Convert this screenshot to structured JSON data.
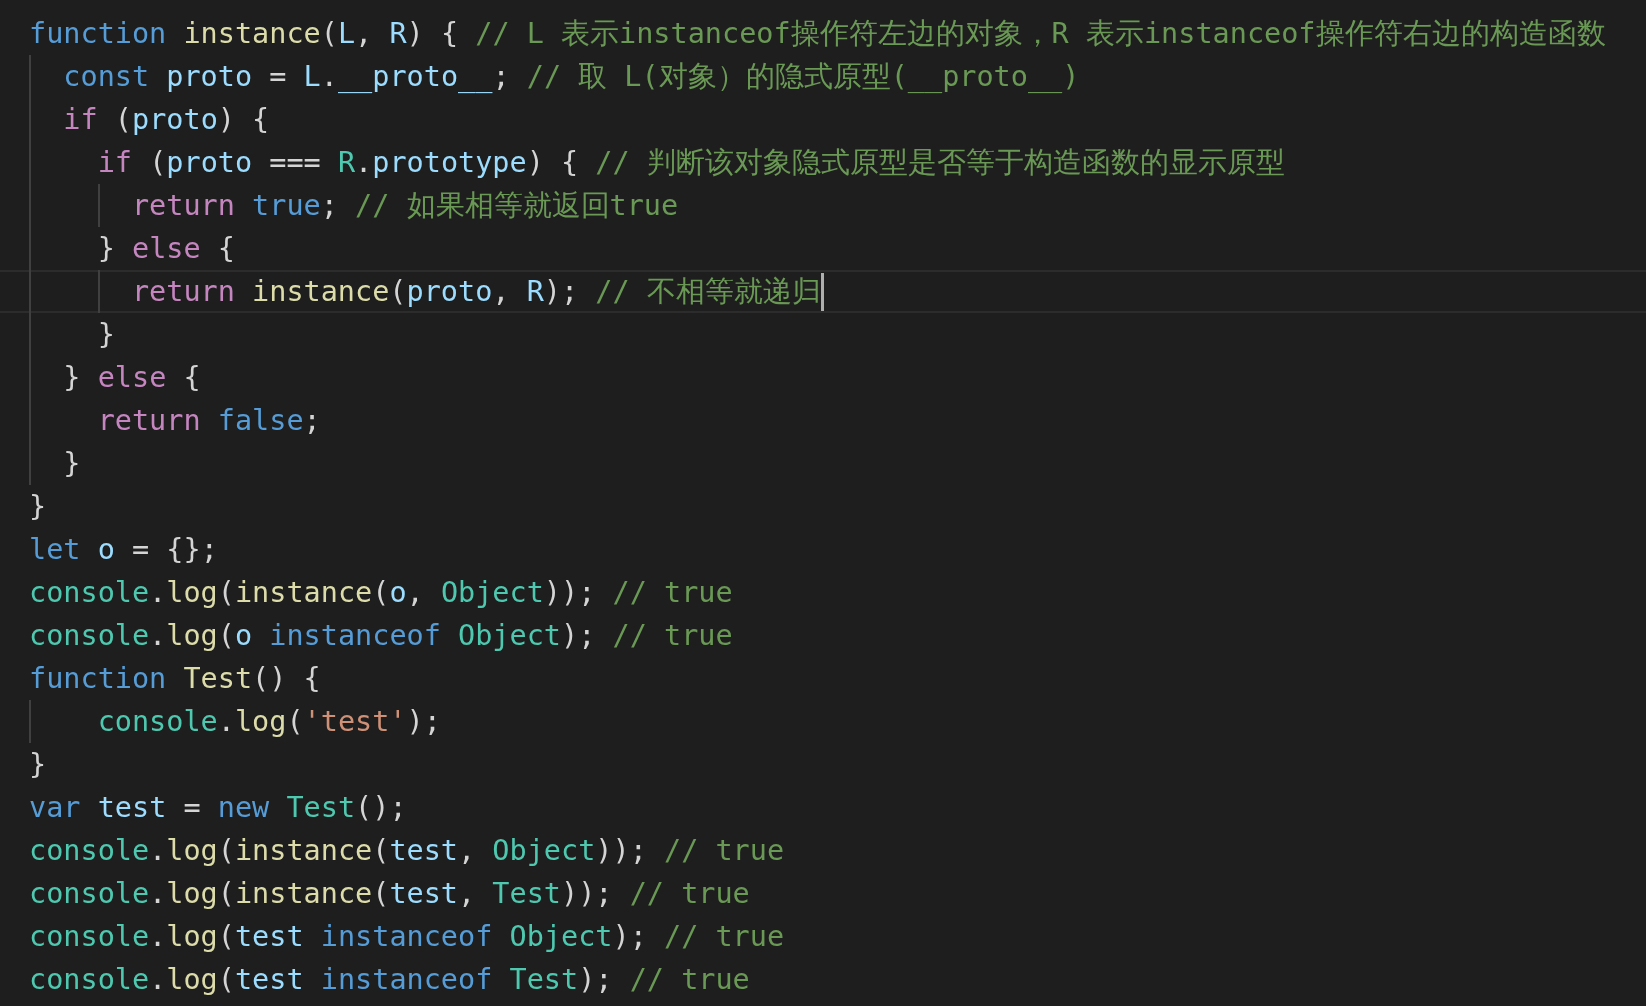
{
  "editor": {
    "lines": [
      {
        "selected": false,
        "tokens": [
          {
            "text": "function",
            "kind": "keyword"
          },
          {
            "text": " instance",
            "kind": "func"
          },
          {
            "text": "(",
            "kind": "punct"
          },
          {
            "text": "L",
            "kind": "var"
          },
          {
            "text": ", ",
            "kind": "punct"
          },
          {
            "text": "R",
            "kind": "var"
          },
          {
            "text": ") {",
            "kind": "punct"
          },
          {
            "text": " // L 表示instanceof操作符左边的对象，R 表示instanceof操作符右边的构造函数",
            "kind": "comment"
          }
        ]
      },
      {
        "selected": false,
        "tokens": [
          {
            "text": "  const",
            "kind": "keyword"
          },
          {
            "text": " proto",
            "kind": "var"
          },
          {
            "text": " = ",
            "kind": "punct"
          },
          {
            "text": "L",
            "kind": "var"
          },
          {
            "text": ".",
            "kind": "punct"
          },
          {
            "text": "__proto__",
            "kind": "var"
          },
          {
            "text": ";",
            "kind": "punct"
          },
          {
            "text": " // 取 L(对象）的隐式原型(__proto__)",
            "kind": "comment"
          }
        ]
      },
      {
        "selected": false,
        "tokens": [
          {
            "text": "  if",
            "kind": "control"
          },
          {
            "text": " (",
            "kind": "punct"
          },
          {
            "text": "proto",
            "kind": "var"
          },
          {
            "text": ") {",
            "kind": "punct"
          }
        ]
      },
      {
        "selected": false,
        "tokens": [
          {
            "text": "    if",
            "kind": "control"
          },
          {
            "text": " (",
            "kind": "punct"
          },
          {
            "text": "proto",
            "kind": "var"
          },
          {
            "text": " === ",
            "kind": "punct"
          },
          {
            "text": "R",
            "kind": "class"
          },
          {
            "text": ".",
            "kind": "punct"
          },
          {
            "text": "prototype",
            "kind": "var"
          },
          {
            "text": ") {",
            "kind": "punct"
          },
          {
            "text": " // 判断该对象隐式原型是否等于构造函数的显示原型",
            "kind": "comment"
          }
        ]
      },
      {
        "selected": false,
        "tokens": [
          {
            "text": "      return",
            "kind": "control"
          },
          {
            "text": " true",
            "kind": "keyword"
          },
          {
            "text": ";",
            "kind": "punct"
          },
          {
            "text": " // 如果相等就返回true",
            "kind": "comment"
          }
        ]
      },
      {
        "selected": false,
        "tokens": [
          {
            "text": "    }",
            "kind": "punct"
          },
          {
            "text": " else",
            "kind": "control"
          },
          {
            "text": " {",
            "kind": "punct"
          }
        ]
      },
      {
        "selected": true,
        "tokens": [
          {
            "text": "      return",
            "kind": "control"
          },
          {
            "text": " instance",
            "kind": "func"
          },
          {
            "text": "(",
            "kind": "punct"
          },
          {
            "text": "proto",
            "kind": "var"
          },
          {
            "text": ", ",
            "kind": "punct"
          },
          {
            "text": "R",
            "kind": "var"
          },
          {
            "text": ");",
            "kind": "punct"
          },
          {
            "text": " // 不相等就递归",
            "kind": "comment"
          }
        ]
      },
      {
        "selected": false,
        "tokens": [
          {
            "text": "    }",
            "kind": "punct"
          }
        ]
      },
      {
        "selected": false,
        "tokens": [
          {
            "text": "  }",
            "kind": "punct"
          },
          {
            "text": " else",
            "kind": "control"
          },
          {
            "text": " {",
            "kind": "punct"
          }
        ]
      },
      {
        "selected": false,
        "tokens": [
          {
            "text": "    return",
            "kind": "control"
          },
          {
            "text": " false",
            "kind": "keyword"
          },
          {
            "text": ";",
            "kind": "punct"
          }
        ]
      },
      {
        "selected": false,
        "tokens": [
          {
            "text": "  }",
            "kind": "punct"
          }
        ]
      },
      {
        "selected": false,
        "tokens": [
          {
            "text": "}",
            "kind": "punct"
          }
        ]
      },
      {
        "selected": false,
        "tokens": [
          {
            "text": "let",
            "kind": "keyword"
          },
          {
            "text": " o",
            "kind": "var"
          },
          {
            "text": " = {};",
            "kind": "punct"
          }
        ]
      },
      {
        "selected": false,
        "tokens": [
          {
            "text": "console",
            "kind": "class"
          },
          {
            "text": ".",
            "kind": "punct"
          },
          {
            "text": "log",
            "kind": "func"
          },
          {
            "text": "(",
            "kind": "punct"
          },
          {
            "text": "instance",
            "kind": "func"
          },
          {
            "text": "(",
            "kind": "punct"
          },
          {
            "text": "o",
            "kind": "var"
          },
          {
            "text": ", ",
            "kind": "punct"
          },
          {
            "text": "Object",
            "kind": "class"
          },
          {
            "text": "));",
            "kind": "punct"
          },
          {
            "text": " // true",
            "kind": "comment"
          }
        ]
      },
      {
        "selected": false,
        "tokens": [
          {
            "text": "console",
            "kind": "class"
          },
          {
            "text": ".",
            "kind": "punct"
          },
          {
            "text": "log",
            "kind": "func"
          },
          {
            "text": "(",
            "kind": "punct"
          },
          {
            "text": "o",
            "kind": "var"
          },
          {
            "text": " instanceof",
            "kind": "keyword"
          },
          {
            "text": " Object",
            "kind": "class"
          },
          {
            "text": ");",
            "kind": "punct"
          },
          {
            "text": " // true",
            "kind": "comment"
          }
        ]
      },
      {
        "selected": false,
        "tokens": [
          {
            "text": "function",
            "kind": "keyword"
          },
          {
            "text": " Test",
            "kind": "func"
          },
          {
            "text": "() {",
            "kind": "punct"
          }
        ]
      },
      {
        "selected": false,
        "tokens": [
          {
            "text": "    console",
            "kind": "class"
          },
          {
            "text": ".",
            "kind": "punct"
          },
          {
            "text": "log",
            "kind": "func"
          },
          {
            "text": "(",
            "kind": "punct"
          },
          {
            "text": "'test'",
            "kind": "string"
          },
          {
            "text": ");",
            "kind": "punct"
          }
        ]
      },
      {
        "selected": false,
        "tokens": [
          {
            "text": "}",
            "kind": "punct"
          }
        ]
      },
      {
        "selected": false,
        "tokens": [
          {
            "text": "var",
            "kind": "keyword"
          },
          {
            "text": " test",
            "kind": "var"
          },
          {
            "text": " = ",
            "kind": "punct"
          },
          {
            "text": "new",
            "kind": "keyword"
          },
          {
            "text": " Test",
            "kind": "class"
          },
          {
            "text": "();",
            "kind": "punct"
          }
        ]
      },
      {
        "selected": false,
        "tokens": [
          {
            "text": "console",
            "kind": "class"
          },
          {
            "text": ".",
            "kind": "punct"
          },
          {
            "text": "log",
            "kind": "func"
          },
          {
            "text": "(",
            "kind": "punct"
          },
          {
            "text": "instance",
            "kind": "func"
          },
          {
            "text": "(",
            "kind": "punct"
          },
          {
            "text": "test",
            "kind": "var"
          },
          {
            "text": ", ",
            "kind": "punct"
          },
          {
            "text": "Object",
            "kind": "class"
          },
          {
            "text": "));",
            "kind": "punct"
          },
          {
            "text": " // true",
            "kind": "comment"
          }
        ]
      },
      {
        "selected": false,
        "tokens": [
          {
            "text": "console",
            "kind": "class"
          },
          {
            "text": ".",
            "kind": "punct"
          },
          {
            "text": "log",
            "kind": "func"
          },
          {
            "text": "(",
            "kind": "punct"
          },
          {
            "text": "instance",
            "kind": "func"
          },
          {
            "text": "(",
            "kind": "punct"
          },
          {
            "text": "test",
            "kind": "var"
          },
          {
            "text": ", ",
            "kind": "punct"
          },
          {
            "text": "Test",
            "kind": "class"
          },
          {
            "text": "));",
            "kind": "punct"
          },
          {
            "text": " // true",
            "kind": "comment"
          }
        ]
      },
      {
        "selected": false,
        "tokens": [
          {
            "text": "console",
            "kind": "class"
          },
          {
            "text": ".",
            "kind": "punct"
          },
          {
            "text": "log",
            "kind": "func"
          },
          {
            "text": "(",
            "kind": "punct"
          },
          {
            "text": "test",
            "kind": "var"
          },
          {
            "text": " instanceof",
            "kind": "keyword"
          },
          {
            "text": " Object",
            "kind": "class"
          },
          {
            "text": ");",
            "kind": "punct"
          },
          {
            "text": " // true",
            "kind": "comment"
          }
        ]
      },
      {
        "selected": false,
        "tokens": [
          {
            "text": "console",
            "kind": "class"
          },
          {
            "text": ".",
            "kind": "punct"
          },
          {
            "text": "log",
            "kind": "func"
          },
          {
            "text": "(",
            "kind": "punct"
          },
          {
            "text": "test",
            "kind": "var"
          },
          {
            "text": " instanceof",
            "kind": "keyword"
          },
          {
            "text": " Test",
            "kind": "class"
          },
          {
            "text": ");",
            "kind": "punct"
          },
          {
            "text": " // true",
            "kind": "comment"
          }
        ]
      }
    ]
  }
}
